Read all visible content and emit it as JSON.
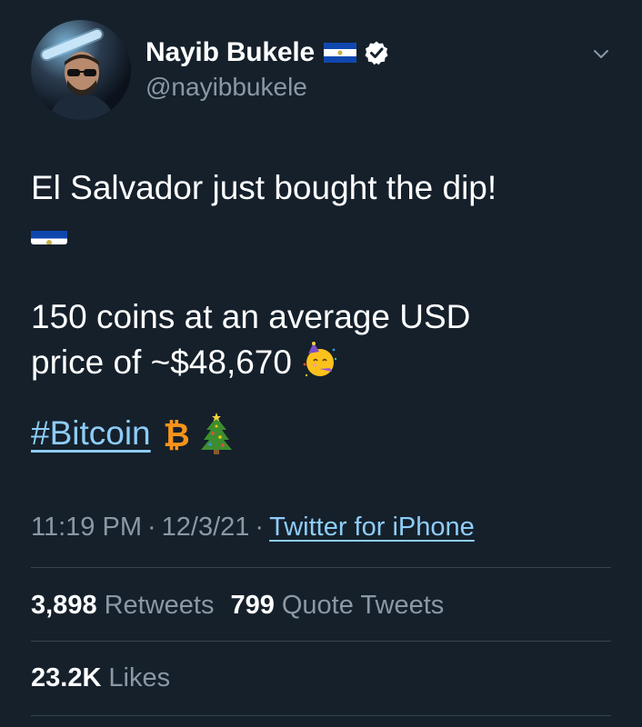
{
  "author": {
    "display_name": "Nayib Bukele",
    "handle": "@nayibbukele",
    "verified_icon": "verified-badge-icon",
    "flag_icon": "el-salvador-flag-icon"
  },
  "tweet": {
    "line1": "El Salvador just bought the dip!",
    "para2_line1": "150 coins at an average USD",
    "para2_line2": "price of ~$48,670",
    "hashtag": "#Bitcoin",
    "emojis": [
      "el-salvador-flag-icon",
      "partying-face-icon",
      "bitcoin-icon",
      "christmas-tree-icon"
    ]
  },
  "meta": {
    "time": "11:19 PM",
    "separator": "·",
    "date": "12/3/21",
    "source": "Twitter for iPhone"
  },
  "stats": {
    "retweets_count": "3,898",
    "retweets_label": "Retweets",
    "quotes_count": "799",
    "quotes_label": "Quote Tweets",
    "likes_count": "23.2K",
    "likes_label": "Likes"
  },
  "colors": {
    "background": "#15202b",
    "text": "#ffffff",
    "secondary": "#8b98a5",
    "link": "#8ecdf8",
    "divider": "#38444d",
    "bitcoin": "#f7931a"
  }
}
